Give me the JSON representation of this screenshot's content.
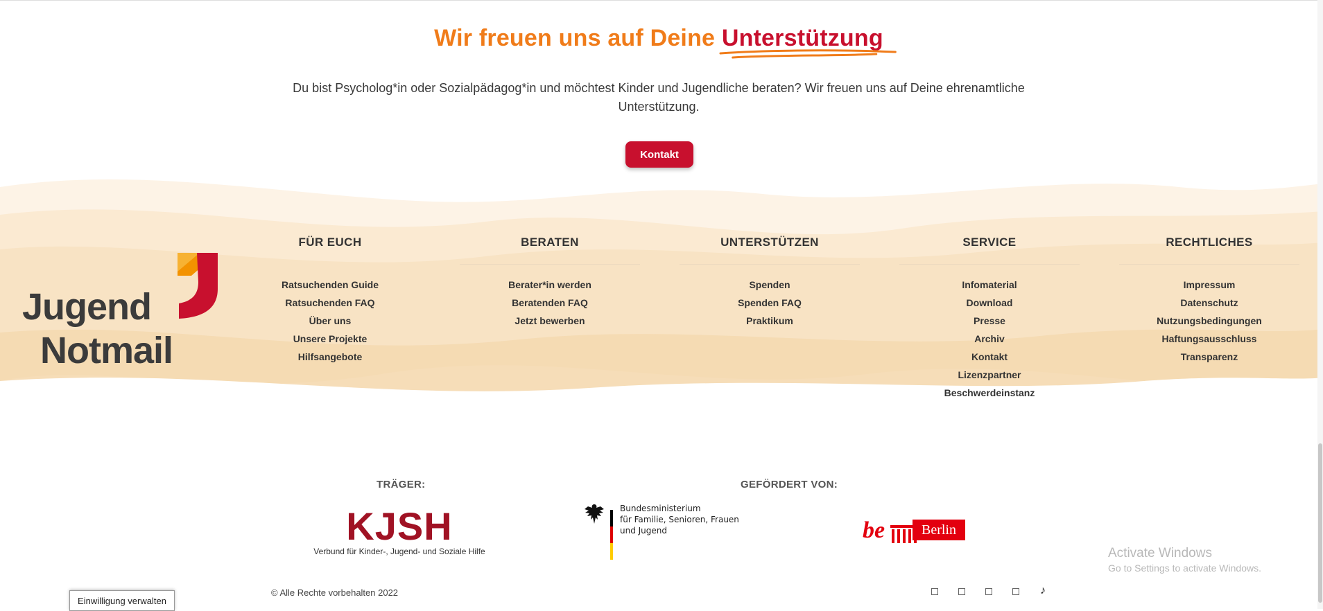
{
  "cta": {
    "headline_prefix": "Wir freuen uns auf Deine",
    "headline_highlight": "Unterstützung",
    "intro": "Du bist Psycholog*in oder Sozialpädagog*in und möchtest Kinder und Jugendliche beraten? Wir freuen uns auf Deine ehrenamtliche Unterstützung.",
    "button": "Kontakt"
  },
  "logo": {
    "line1": "Jugend",
    "line2": "Notmail"
  },
  "footer": {
    "columns": [
      {
        "title": "FÜR EUCH",
        "links": [
          "Ratsuchenden Guide",
          "Ratsuchenden FAQ",
          "Über uns",
          "Unsere Projekte",
          "Hilfsangebote"
        ]
      },
      {
        "title": "BERATEN",
        "links": [
          "Berater*in werden",
          "Beratenden FAQ",
          "Jetzt bewerben"
        ]
      },
      {
        "title": "UNTERSTÜTZEN",
        "links": [
          "Spenden",
          "Spenden FAQ",
          "Praktikum"
        ]
      },
      {
        "title": "SERVICE",
        "links": [
          "Infomaterial",
          "Download",
          "Presse",
          "Archiv",
          "Kontakt",
          "Lizenzpartner",
          "Beschwerdeinstanz"
        ]
      },
      {
        "title": "RECHTLICHES",
        "links": [
          "Impressum",
          "Datenschutz",
          "Nutzungsbedingungen",
          "Haftungsausschluss",
          "Transparenz"
        ]
      }
    ]
  },
  "sponsors": {
    "traeger_label": "TRÄGER:",
    "gefoerdert_label": "GEFÖRDERT VON:",
    "kjsh_name": "KJSH",
    "kjsh_sub": "Verbund für Kinder-, Jugend- und Soziale Hilfe",
    "bmfsfj_lines": [
      "Bundesministerium",
      "für Familie, Senioren, Frauen",
      "und Jugend"
    ],
    "berlin_prefix": "be",
    "berlin_name": "Berlin"
  },
  "system": {
    "activate_title": "Activate Windows",
    "activate_sub": "Go to Settings to activate Windows."
  },
  "bottom": {
    "copyright": "© Alle Rechte vorbehalten 2022",
    "consent": "Einwilligung verwalten",
    "social_icons": [
      "facebook-icon",
      "instagram-icon",
      "twitter-icon",
      "youtube-icon",
      "tiktok-icon"
    ],
    "tiktok_glyph": "♪"
  },
  "colors": {
    "orange": "#f07c1a",
    "red": "#c8102e",
    "wave": "#f8e3c4"
  }
}
